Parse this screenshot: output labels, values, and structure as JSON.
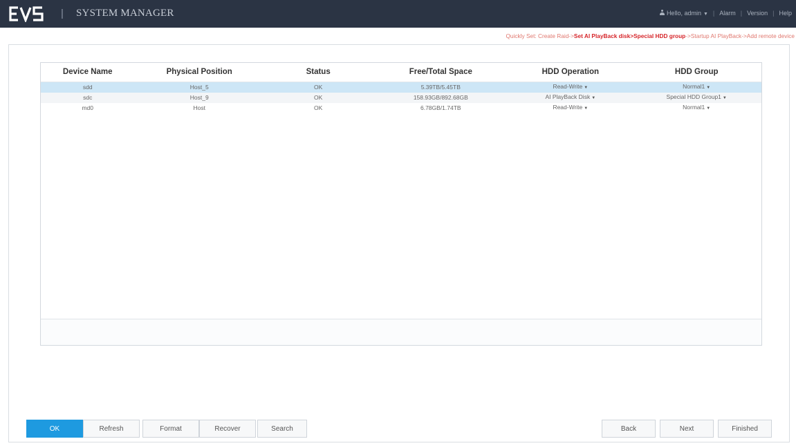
{
  "header": {
    "title": "SYSTEM MANAGER",
    "separator": "|",
    "greeting": "Hello, admin",
    "nav_sep": "|",
    "alarm": "Alarm",
    "version": "Version",
    "help": "Help"
  },
  "quickset": {
    "prefix": "Quickly Set: Create Raid->",
    "step_ai_playback": "Set AI PlayBack disk",
    "arrow": ">",
    "step_special_group": "Special HDD group",
    "suffix": "->Startup AI PlayBack->Add remote device"
  },
  "table": {
    "columns": [
      "Device Name",
      "Physical Position",
      "Status",
      "Free/Total Space",
      "HDD Operation",
      "HDD Group"
    ],
    "rows": [
      {
        "device": "sdd",
        "position": "Host_5",
        "status": "OK",
        "space": "5.39TB/5.45TB",
        "operation": "Read-Write",
        "group": "Normal1"
      },
      {
        "device": "sdc",
        "position": "Host_9",
        "status": "OK",
        "space": "158.93GB/892.68GB",
        "operation": "AI PlayBack Disk",
        "group": "Special HDD Group1"
      },
      {
        "device": "md0",
        "position": "Host",
        "status": "OK",
        "space": "6.78GB/1.74TB",
        "operation": "Read-Write",
        "group": "Normal1"
      }
    ]
  },
  "buttons": {
    "ok": "OK",
    "refresh": "Refresh",
    "format": "Format",
    "recover": "Recover",
    "search": "Search",
    "back": "Back",
    "next": "Next",
    "finished": "Finished"
  },
  "colors": {
    "topbar": "#2b3444",
    "accent": "#1e9ae0",
    "selected_row": "#cde6f6",
    "quickset_red": "#d6252a"
  }
}
